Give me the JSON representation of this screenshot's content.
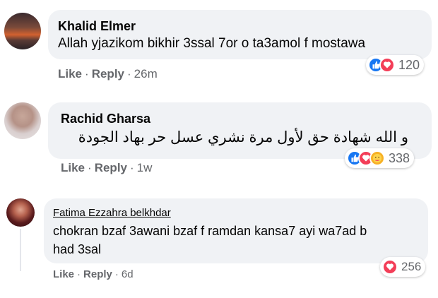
{
  "comments": [
    {
      "author": "Khalid Elmer",
      "text": "Allah yjazikom bikhir 3ssal 7or o ta3amol f mostawa",
      "like_label": "Like",
      "reply_label": "Reply",
      "time": "26m",
      "reactions": [
        "like",
        "love"
      ],
      "reaction_count": "120"
    },
    {
      "author": "Rachid Gharsa",
      "text": "و الله شهادة حق لأول مرة نشري عسل حر بهاد الجودة",
      "like_label": "Like",
      "reply_label": "Reply",
      "time": "1w",
      "reactions": [
        "like",
        "love",
        "care"
      ],
      "reaction_count": "338"
    },
    {
      "author": "Fatima Ezzahra belkhdar",
      "text_line1": "chokran bzaf 3awani bzaf f ramdan kansa7 ayi wa7ad b",
      "text_line2": "had 3sal",
      "like_label": "Like",
      "reply_label": "Reply",
      "time": "6d",
      "reactions": [
        "love"
      ],
      "reaction_count": "256"
    }
  ],
  "colors": {
    "like": "#1877f2",
    "love": "#f33e58",
    "care": "#f7b125",
    "bubble": "#f0f2f5",
    "meta": "#65676b"
  }
}
